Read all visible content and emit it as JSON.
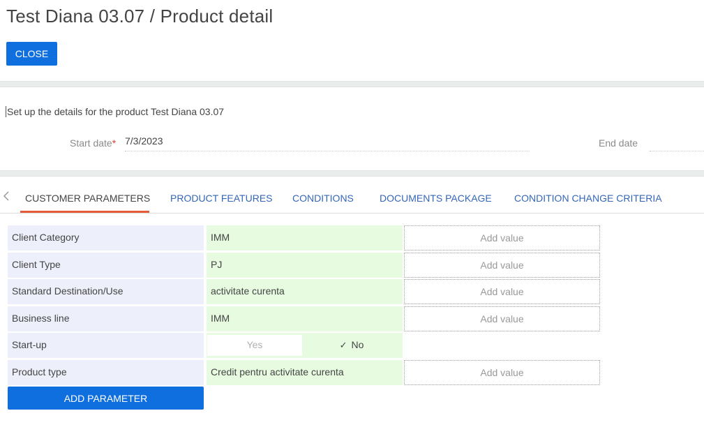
{
  "header": {
    "title": "Test Diana 03.07 / Product detail",
    "close_label": "CLOSE"
  },
  "details": {
    "subtitle": "Set up the details for the product Test Diana 03.07",
    "start_date_label": "Start date",
    "required_mark": "*",
    "start_date_value": "7/3/2023",
    "end_date_label": "End date",
    "end_date_value": ""
  },
  "tabs": [
    {
      "label": "CUSTOMER PARAMETERS",
      "active": true
    },
    {
      "label": "PRODUCT FEATURES",
      "active": false
    },
    {
      "label": "CONDITIONS",
      "active": false
    },
    {
      "label": "DOCUMENTS PACKAGE",
      "active": false
    },
    {
      "label": "CONDITION CHANGE CRITERIA",
      "active": false
    }
  ],
  "tab_nav_icon": "chevron-left-icon",
  "parameters": [
    {
      "name": "Client Category",
      "value": "IMM",
      "add_label": "Add value"
    },
    {
      "name": "Client Type",
      "value": "PJ",
      "add_label": "Add value"
    },
    {
      "name": "Standard Destination/Use",
      "value": "activitate curenta",
      "add_label": "Add value"
    },
    {
      "name": "Business line",
      "value": "IMM",
      "add_label": "Add value"
    },
    {
      "name": "Start-up",
      "toggle_yes": "Yes",
      "toggle_no": "No",
      "selected": "No"
    },
    {
      "name": "Product type",
      "value": "Credit pentru activitate curenta",
      "add_label": "Add value"
    }
  ],
  "add_parameter_label": "ADD PARAMETER",
  "colors": {
    "primary_button": "#0f6fde",
    "active_tab_underline": "#e45b3c",
    "tab_link": "#3466b8",
    "param_name_bg": "#edf0fb",
    "param_value_bg": "#e6fbe0"
  }
}
